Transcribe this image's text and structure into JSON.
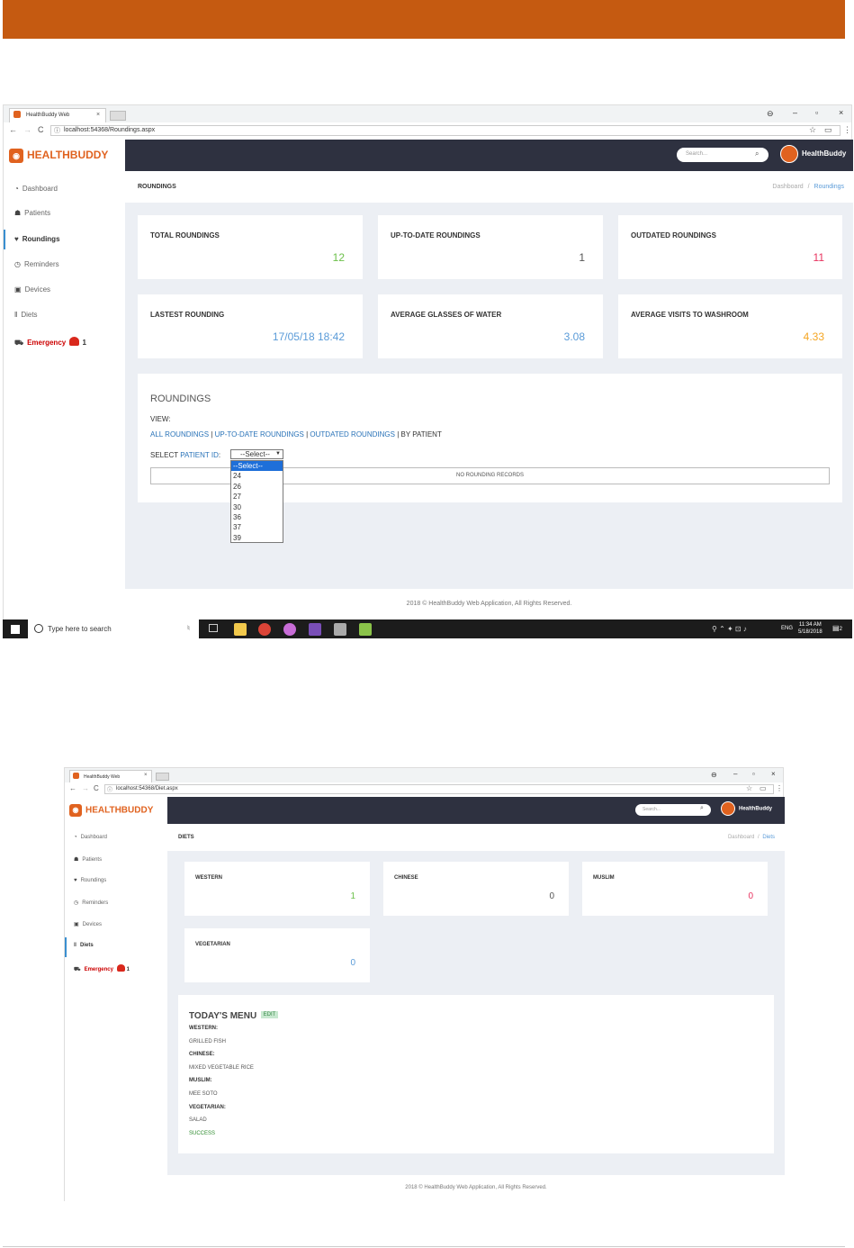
{
  "colors": {
    "accent": "#e0621f",
    "header": "#2e3140",
    "link": "#2a73b8",
    "green": "#6cc04a",
    "red": "#e8335f",
    "blue": "#5a9bd8",
    "orange": "#f5a623",
    "topbar": "#c55a11"
  },
  "screen1": {
    "tab_title": "HealthBuddy Web",
    "url": "localhost:54368/Roundings.aspx",
    "brand": "HEALTHBUDDY",
    "search_placeholder": "Search...",
    "user": "HealthBuddy",
    "nav": {
      "dashboard": "Dashboard",
      "patients": "Patients",
      "roundings": "Roundings",
      "reminders": "Reminders",
      "devices": "Devices",
      "diets": "Diets",
      "emergency": "Emergency",
      "emergency_count": "1"
    },
    "page_title": "ROUNDINGS",
    "breadcrumb": {
      "home": "Dashboard",
      "sep": "/",
      "current": "Roundings"
    },
    "cards": [
      {
        "title": "TOTAL ROUNDINGS",
        "value": "12"
      },
      {
        "title": "UP-TO-DATE ROUNDINGS",
        "value": "1"
      },
      {
        "title": "OUTDATED ROUNDINGS",
        "value": "11"
      },
      {
        "title": "LASTEST ROUNDING",
        "value": "17/05/18 18:42"
      },
      {
        "title": "AVERAGE GLASSES OF WATER",
        "value": "3.08"
      },
      {
        "title": "AVERAGE VISITS TO WASHROOM",
        "value": "4.33"
      }
    ],
    "panel": {
      "heading": "ROUNDINGS",
      "view_label": "VIEW:",
      "links": [
        "ALL ROUNDINGS",
        "UP-TO-DATE ROUNDINGS",
        "OUTDATED ROUNDINGS"
      ],
      "sep": "|",
      "current": "BY PATIENT",
      "select_prefix": "SELECT ",
      "select_link": "PATIENT ID",
      "select_suffix": ":",
      "select_value": "--Select--",
      "options": [
        "--Select--",
        "24",
        "26",
        "27",
        "30",
        "36",
        "37",
        "39"
      ],
      "empty": "NO ROUNDING RECORDS"
    },
    "footer": "2018 © HealthBuddy Web Application, All Rights Reserved.",
    "taskbar": {
      "search": "Type here to search",
      "lang": "ENG",
      "time": "11:34 AM",
      "date": "5/18/2018",
      "notif": "2"
    }
  },
  "screen2": {
    "tab_title": "HealthBuddy Web",
    "url": "localhost:54368/Diet.aspx",
    "brand": "HEALTHBUDDY",
    "search_placeholder": "Search...",
    "user": "HealthBuddy",
    "nav": {
      "dashboard": "Dashboard",
      "patients": "Patients",
      "roundings": "Roundings",
      "reminders": "Reminders",
      "devices": "Devices",
      "diets": "Diets",
      "emergency": "Emergency",
      "emergency_count": "1"
    },
    "page_title": "DIETS",
    "breadcrumb": {
      "home": "Dashboard",
      "sep": "/",
      "current": "Diets"
    },
    "cards": [
      {
        "title": "WESTERN",
        "value": "1"
      },
      {
        "title": "CHINESE",
        "value": "0"
      },
      {
        "title": "MUSLIM",
        "value": "0"
      },
      {
        "title": "VEGETARIAN",
        "value": "0"
      }
    ],
    "menu": {
      "heading": "TODAY'S MENU",
      "edit": "EDIT",
      "western_label": "WESTERN:",
      "western": "GRILLED FISH",
      "chinese_label": "CHINESE:",
      "chinese": "MIXED VEGETABLE RICE",
      "muslim_label": "MUSLIM:",
      "muslim": "MEE SOTO",
      "vegetarian_label": "VEGETARIAN:",
      "vegetarian": "SALAD",
      "status": "SUCCESS"
    },
    "footer": "2018 © HealthBuddy Web Application, All Rights Reserved."
  }
}
